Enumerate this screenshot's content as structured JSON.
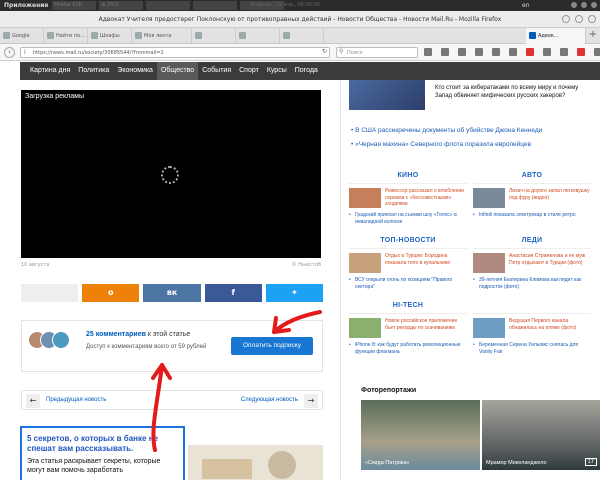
{
  "os": {
    "apps_label": "Приложения",
    "tasks": [
      "Firefox ESR",
      "⊕ 25°C",
      "",
      "",
      "",
      ""
    ],
    "clock": "Вторник, 25 апр., 06:00:00",
    "lang": "en"
  },
  "window": {
    "title": "Адвокат Учителя предостерег Поклонскую от противоправных действий - Новости Общества - Новости Mail.Ru - Mozilla Firefox"
  },
  "browser": {
    "tabs": [
      {
        "label": "Google",
        "active": false
      },
      {
        "label": "Найти по...",
        "active": false
      },
      {
        "label": "Шкафы",
        "active": false
      },
      {
        "label": "Моя лента",
        "active": false
      },
      {
        "label": "",
        "active": false
      },
      {
        "label": "",
        "active": false
      },
      {
        "label": "",
        "active": false
      },
      {
        "label": "Адвок...",
        "active": true
      }
    ],
    "url": "https://news.mail.ru/society/30685544/?frommail=1",
    "search_placeholder": "Поиск"
  },
  "sitemenu": {
    "items": [
      "Картина дня",
      "Политика",
      "Экономика",
      "Общество",
      "События",
      "Спорт",
      "Курсы",
      "Погода"
    ],
    "active": "Общество"
  },
  "video": {
    "ad_label": "Загрузка рекламы",
    "date": "10 августа",
    "source": "© Ньюстоб"
  },
  "share": {
    "ok_icon": "odnoklassniki-icon",
    "vk_label": "вк",
    "fb_label": "f",
    "tw_icon": "twitter-icon"
  },
  "comments": {
    "count_text": "25 комментариев",
    "title_rest": " к этой статье",
    "desc": "Доступ к комментариям всего от 59 рублей",
    "pay_button": "Оплатить подписку"
  },
  "pager": {
    "prev": "Предыдущая новость",
    "next": "Следующая новость"
  },
  "promo": {
    "title": "5 секретов, о которых в банке не спешат вам рассказывать.",
    "text": "Эта статья раскрывает секреты, которые могут вам помочь заработать"
  },
  "right": {
    "top_story": "Кто стоит за кибератаками по всему миру и почему Запад обвиняет мифических русских хакеров?",
    "links": [
      "В США рассекречены документы об убийстве Джона Кеннеди",
      "«Черная махина» Северного флота поразила европейцев"
    ],
    "cats": {
      "kino": {
        "head": "КИНО",
        "item": "Режиссер рассказал о влюблении сериала с «бессовестными» злодеями",
        "link": "Градский приехал на съемки шоу «Голос» в инвалидной коляске"
      },
      "avto": {
        "head": "АВТО",
        "item": "Лихач на дороге запал легковушку под фуру (видео)",
        "link": "Infiniti показала электрокар в стиле ретро"
      },
      "tour": {
        "head": "ТОП-НОВОСТИ",
        "item": "Отдых в Турции: Бородина показала тело в купальнике",
        "link": "ВСУ открыли огонь по позициям \"Правого сектора\""
      },
      "ledi": {
        "head": "ЛЕДИ",
        "item": "Анастасия Стриженова и ее муж Петр отдыхают в Турции (фото)",
        "link": "39-летняя Екатерина Климова выглядит как подросток (фото)"
      },
      "hitech": {
        "head": "HI-TECH",
        "item": "Новое российское приложение бьет рекорды по скачиваниям",
        "link": "iPhone 8: как будут работать революционные функции флагмана"
      },
      "devushka": {
        "head": "",
        "item": "Ведущая Первого канала обнажилась на пляже (фото)",
        "link": "Беременная Серена Уильямс снялась для Vanity Fair"
      }
    },
    "photo_head": "Фоторепортажи",
    "photos": [
      {
        "caption": "«Скида Патрика»",
        "count": ""
      },
      {
        "caption": "Мрамор Микеланджело",
        "count": "17"
      }
    ]
  },
  "colors": {
    "menu_bg": "#3b3b3b",
    "accent_blue": "#1976d2",
    "annotation_red": "#e41b1b"
  }
}
